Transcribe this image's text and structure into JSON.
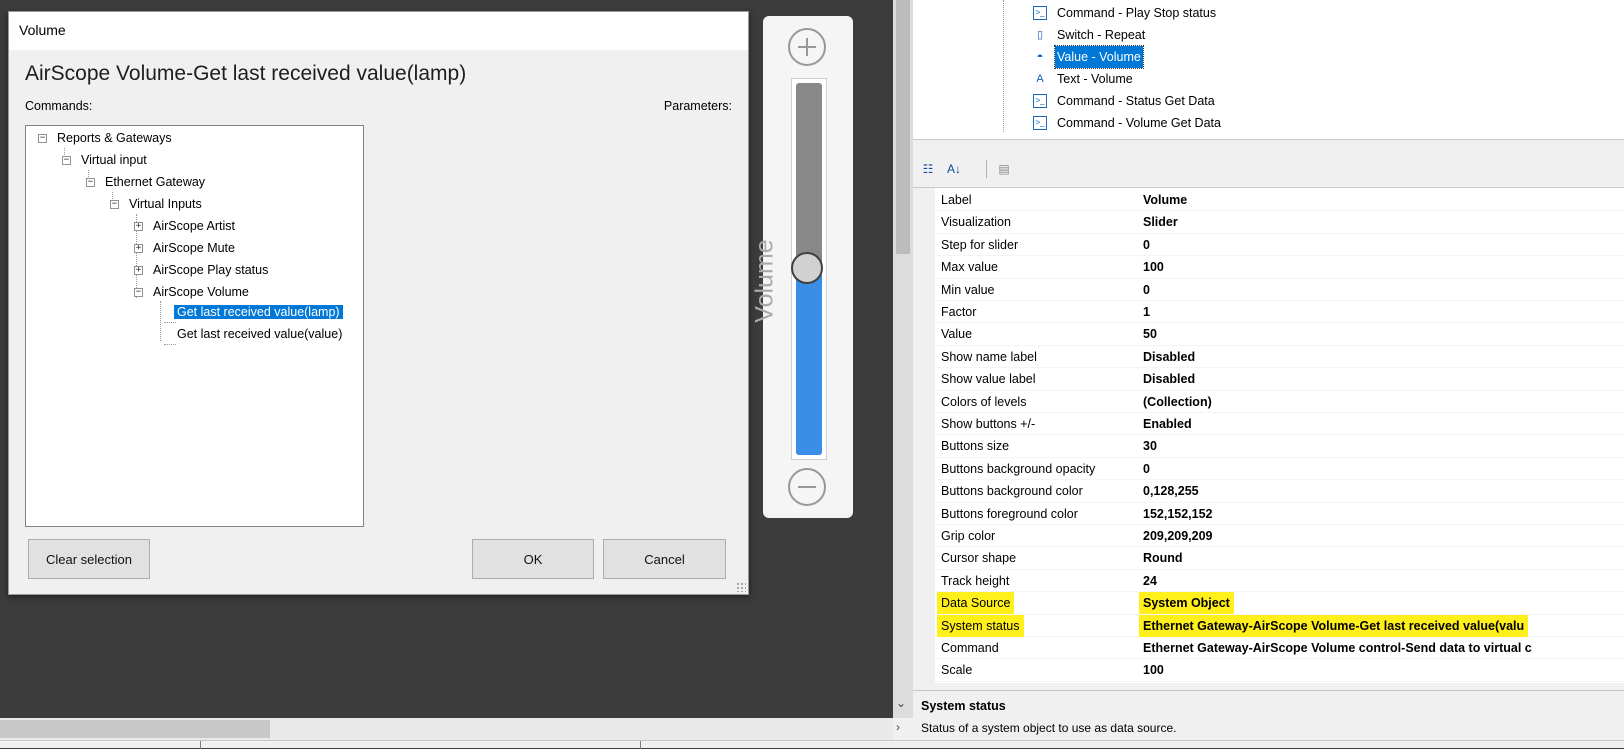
{
  "dialog": {
    "title": "Volume",
    "heading": "AirScope Volume-Get last received value(lamp)",
    "commands_label": "Commands:",
    "parameters_label": "Parameters:",
    "tree": [
      {
        "label": "Reports & Gateways",
        "level": 0,
        "expander": "minus"
      },
      {
        "label": "Virtual input",
        "level": 1,
        "expander": "minus"
      },
      {
        "label": "Ethernet Gateway",
        "level": 2,
        "expander": "minus"
      },
      {
        "label": "Virtual Inputs",
        "level": 3,
        "expander": "minus"
      },
      {
        "label": "AirScope Artist",
        "level": 4,
        "expander": "plus"
      },
      {
        "label": "AirScope Mute",
        "level": 4,
        "expander": "plus"
      },
      {
        "label": "AirScope Play status",
        "level": 4,
        "expander": "plus"
      },
      {
        "label": "AirScope Volume",
        "level": 4,
        "expander": "minus"
      },
      {
        "label": "Get last received value(lamp)",
        "level": 5,
        "expander": "none",
        "selected": true
      },
      {
        "label": "Get last received value(value)",
        "level": 5,
        "expander": "none"
      }
    ],
    "clear_selection": "Clear  selection",
    "ok": "OK",
    "cancel": "Cancel"
  },
  "slider": {
    "name": "Volume",
    "value": 50,
    "min": 0,
    "max": 100,
    "fill_color": "#3a8ee8",
    "track_color": "#888888",
    "icons": {
      "plus": "plus-circle-icon",
      "minus": "minus-circle-icon"
    }
  },
  "object_tree": [
    {
      "label": "Command - Play Stop status",
      "icon": "command-icon"
    },
    {
      "label": "Switch - Repeat",
      "icon": "switch-icon"
    },
    {
      "label": "Value - Volume",
      "icon": "gauge-icon",
      "selected": true
    },
    {
      "label": "Text - Volume",
      "icon": "text-icon"
    },
    {
      "label": "Command - Status Get Data",
      "icon": "command-icon"
    },
    {
      "label": "Command - Volume Get Data",
      "icon": "command-icon"
    }
  ],
  "toolbar": {
    "icons": [
      "categorized-icon",
      "sort-az-icon",
      "property-pages-icon"
    ]
  },
  "properties": [
    {
      "name": "Label",
      "value": "Volume"
    },
    {
      "name": "Visualization",
      "value": "Slider"
    },
    {
      "name": "Step for slider",
      "value": "0"
    },
    {
      "name": "Max value",
      "value": "100"
    },
    {
      "name": "Min value",
      "value": "0"
    },
    {
      "name": "Factor",
      "value": "1"
    },
    {
      "name": "Value",
      "value": "50"
    },
    {
      "name": "Show name label",
      "value": "Disabled"
    },
    {
      "name": "Show value label",
      "value": "Disabled"
    },
    {
      "name": "Colors of levels",
      "value": "(Collection)"
    },
    {
      "name": "Show buttons +/-",
      "value": "Enabled"
    },
    {
      "name": "Buttons size",
      "value": "30"
    },
    {
      "name": "Buttons background opacity",
      "value": "0"
    },
    {
      "name": "Buttons background color",
      "value": "0,128,255"
    },
    {
      "name": "Buttons foreground color",
      "value": "152,152,152"
    },
    {
      "name": "Grip color",
      "value": "209,209,209"
    },
    {
      "name": "Cursor shape",
      "value": "Round"
    },
    {
      "name": "Track height",
      "value": "24"
    },
    {
      "name": "Data Source",
      "value": "System Object",
      "highlight": true
    },
    {
      "name": "System status",
      "value": "Ethernet Gateway-AirScope Volume-Get last received value(valu",
      "highlight": true
    },
    {
      "name": "Command",
      "value": "Ethernet Gateway-AirScope Volume control-Send data to virtual c"
    },
    {
      "name": "Scale",
      "value": "100"
    }
  ],
  "highlight_color": "#ffef1a",
  "description": {
    "title": "System status",
    "text": "Status of a system object to use as data source."
  }
}
